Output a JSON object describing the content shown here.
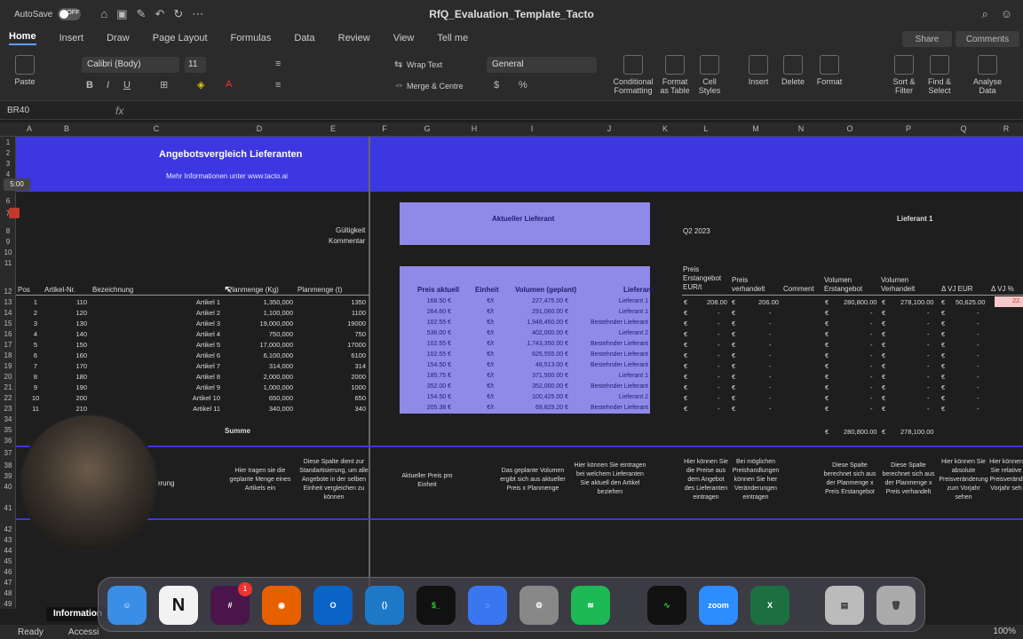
{
  "titlebar": {
    "autosave": "AutoSave",
    "toggle": "OFF",
    "title": "RfQ_Evaluation_Template_Tacto"
  },
  "menu": [
    "Home",
    "Insert",
    "Draw",
    "Page Layout",
    "Formulas",
    "Data",
    "Review",
    "View",
    "Tell me"
  ],
  "share": "Share",
  "comments": "Comments",
  "ribbon": {
    "paste": "Paste",
    "font": "Calibri (Body)",
    "size": "11",
    "wrap": "Wrap Text",
    "merge": "Merge & Centre",
    "numfmt": "General",
    "cond": "Conditional\nFormatting",
    "fmt_table": "Format\nas Table",
    "cell_styles": "Cell\nStyles",
    "insert": "Insert",
    "delete": "Delete",
    "format": "Format",
    "sort": "Sort &\nFilter",
    "find": "Find &\nSelect",
    "analyse": "Analyse\nData"
  },
  "formulabar": {
    "namebox": "BR40",
    "fx": "fx"
  },
  "columns": [
    "A",
    "B",
    "C",
    "D",
    "E",
    "F",
    "G",
    "H",
    "I",
    "J",
    "K",
    "L",
    "M",
    "N",
    "O",
    "P",
    "Q",
    "R"
  ],
  "rows": [
    "1",
    "2",
    "3",
    "4",
    "5",
    "6",
    "7",
    "8",
    "9",
    "10",
    "11",
    "12",
    "13",
    "14",
    "15",
    "16",
    "17",
    "18",
    "19",
    "20",
    "21",
    "22",
    "23",
    "34",
    "35",
    "36",
    "37",
    "38",
    "39",
    "40",
    "41",
    "42",
    "43",
    "44",
    "45",
    "46",
    "47",
    "48",
    "49"
  ],
  "banner": {
    "title": "Angebotsvergleich Lieferanten",
    "subtitle": "Mehr Informationen unter www.tacto.ai"
  },
  "labels": {
    "gueltigkeit": "Gültigkeit",
    "kommentar": "Kommentar",
    "aktueller": "Aktueller Lieferant",
    "q2": "Q2 2023",
    "lieferant1": "Lieferant 1",
    "summe": "Summe",
    "erung": "erung"
  },
  "headers_left": [
    "Pos",
    "Artikel-Nr.",
    "Bezeichnung",
    "Planmenge (Kg)",
    "Planmenge (t)"
  ],
  "headers_mid": [
    "Preis aktuell",
    "Einheit",
    "Volumen (geplant)",
    "Lieferant"
  ],
  "headers_right": [
    "Preis\nErstangebot\nEUR/t",
    "Preis\nverhandelt",
    "Comment",
    "Volumen\nErstangebot",
    "Volumen\nVerhandelt",
    "Δ VJ EUR",
    "Δ VJ %"
  ],
  "table": [
    {
      "pos": "1",
      "nr": "110",
      "name": "Artikel 1",
      "kg": "1,350,000",
      "t": "1350",
      "preis": "168.50 €",
      "einheit": "€/t",
      "vol": "227,475.00 €",
      "lief": "Lieferant 1"
    },
    {
      "pos": "2",
      "nr": "120",
      "name": "Artikel 2",
      "kg": "1,100,000",
      "t": "1100",
      "preis": "264.60 €",
      "einheit": "€/t",
      "vol": "291,060.00 €",
      "lief": "Lieferant 1"
    },
    {
      "pos": "3",
      "nr": "130",
      "name": "Artikel 3",
      "kg": "19,000,000",
      "t": "19000",
      "preis": "102.55 €",
      "einheit": "€/t",
      "vol": "1,948,450.00 €",
      "lief": "Bestehnder Lieferant"
    },
    {
      "pos": "4",
      "nr": "140",
      "name": "Artikel 4",
      "kg": "750,000",
      "t": "750",
      "preis": "536.00 €",
      "einheit": "€/t",
      "vol": "402,000.00 €",
      "lief": "Lieferant 2"
    },
    {
      "pos": "5",
      "nr": "150",
      "name": "Artikel 5",
      "kg": "17,000,000",
      "t": "17000",
      "preis": "102.55 €",
      "einheit": "€/t",
      "vol": "1,743,350.00 €",
      "lief": "Bestehnder Lieferant"
    },
    {
      "pos": "6",
      "nr": "160",
      "name": "Artikel 6",
      "kg": "6,100,000",
      "t": "6100",
      "preis": "102.55 €",
      "einheit": "€/t",
      "vol": "625,555.00 €",
      "lief": "Bestehnder Lieferant"
    },
    {
      "pos": "7",
      "nr": "170",
      "name": "Artikel 7",
      "kg": "314,000",
      "t": "314",
      "preis": "154.50 €",
      "einheit": "€/t",
      "vol": "48,513.00 €",
      "lief": "Bestehnder Lieferant"
    },
    {
      "pos": "8",
      "nr": "180",
      "name": "Artikel 8",
      "kg": "2,000,000",
      "t": "2000",
      "preis": "185.75 €",
      "einheit": "€/t",
      "vol": "371,500.00 €",
      "lief": "Lieferant 1"
    },
    {
      "pos": "9",
      "nr": "190",
      "name": "Artikel 9",
      "kg": "1,000,000",
      "t": "1000",
      "preis": "352.00 €",
      "einheit": "€/t",
      "vol": "352,000.00 €",
      "lief": "Bestehnder Lieferant"
    },
    {
      "pos": "10",
      "nr": "200",
      "name": "Artikel 10",
      "kg": "650,000",
      "t": "650",
      "preis": "154.50 €",
      "einheit": "€/t",
      "vol": "100,425.00 €",
      "lief": "Lieferant 2"
    },
    {
      "pos": "11",
      "nr": "210",
      "name": "Artikel 11",
      "kg": "340,000",
      "t": "340",
      "preis": "205.38 €",
      "einheit": "€/t",
      "vol": "69,829.20 €",
      "lief": "Bestehnder Lieferant"
    }
  ],
  "right_row13": {
    "eur1": "€",
    "l": "208.00",
    "eur2": "€",
    "m": "206.00",
    "eur3": "€",
    "o": "280,800.00",
    "eur4": "€",
    "p": "278,100.00",
    "eur5": "€",
    "q": "50,625.00",
    "r": "22."
  },
  "dash": "-",
  "euro": "€",
  "summe_row": {
    "o_eur": "€",
    "o": "280,800.00",
    "p_eur": "€",
    "p": "278,100.00"
  },
  "notes": [
    "Hier tragen sie die geplante Menge eines Artikels ein",
    "Diese Spalte dient zur Standartisierung, um alle Angebote in der selben Einheit vergleichen zu können",
    "Aktueller Preis pro Einheit",
    "Das geplante Volumen ergibt sich aus aktueller Preis x Planmenge",
    "Hier können Sie eintragen bei welchem Lieferanten Sie aktuell den Artikel beziehen",
    "Hier können Sie die Preise aus dem Angebot des Lieferanten eintragen",
    "Bei möglichen Preishandlungen können Sie hier Veränderungen eintragen",
    "Diese Spalte berechnet sich aus der Planmenge x Preis Erstangebot",
    "Diese Spalte berechnet sich aus der Planmenge x Preis verhandelt",
    "Hier können Sie absolute Preisveränderung zum Vorjahr sehen",
    "Hier können Sie relative Preisveränd Vorjahr seh"
  ],
  "timer": "5:00",
  "dock": [
    "Finder",
    "Notion",
    "Slack",
    "Firefox",
    "Outlook",
    "VS Code",
    "Terminal",
    "Signal",
    "Settings",
    "Spotify",
    "Activity",
    "zoom",
    "Excel",
    "Files",
    "Trash"
  ],
  "dock_badge": "1",
  "sheettab": "Information",
  "status": {
    "ready": "Ready",
    "access": "Accessi",
    "zoom": "100%"
  },
  "colors": {
    "banner": "#3c37e0",
    "purple": "#8f8ae8"
  }
}
